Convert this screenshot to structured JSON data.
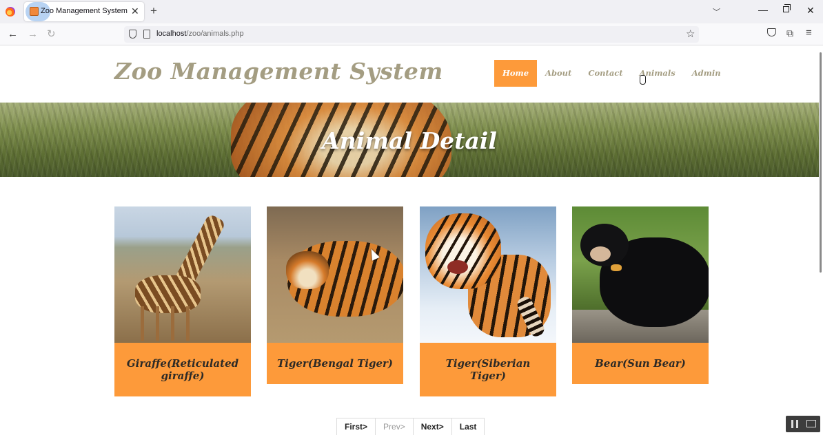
{
  "browser": {
    "tab_title": "Zoo Management System | Animals",
    "tab_close": "✕",
    "new_tab": "+",
    "url_host": "localhost",
    "url_path": "/zoo/animals.php",
    "icons": [
      "firefox-icon",
      "back-arrow-icon",
      "forward-arrow-icon",
      "reload-icon",
      "shield-icon",
      "page-icon",
      "star-icon",
      "pocket-icon",
      "extensions-icon",
      "hamburger-menu-icon"
    ]
  },
  "header": {
    "site_title": "Zoo Management System",
    "menu": [
      "Home",
      "About",
      "Contact",
      "Animals",
      "Admin"
    ],
    "active_menu": "Home",
    "accent_color": "#fd9a3a",
    "title_color": "#a49d82"
  },
  "hero": {
    "title": "Animal Detail"
  },
  "animals": [
    {
      "name": "Giraffe(Reticulated giraffe)"
    },
    {
      "name": "Tiger(Bengal Tiger)"
    },
    {
      "name": "Tiger(Siberian Tiger)"
    },
    {
      "name": "Bear(Sun Bear)"
    }
  ],
  "pagination": {
    "first": "First>",
    "prev": "Prev>",
    "next": "Next>",
    "last": "Last"
  }
}
